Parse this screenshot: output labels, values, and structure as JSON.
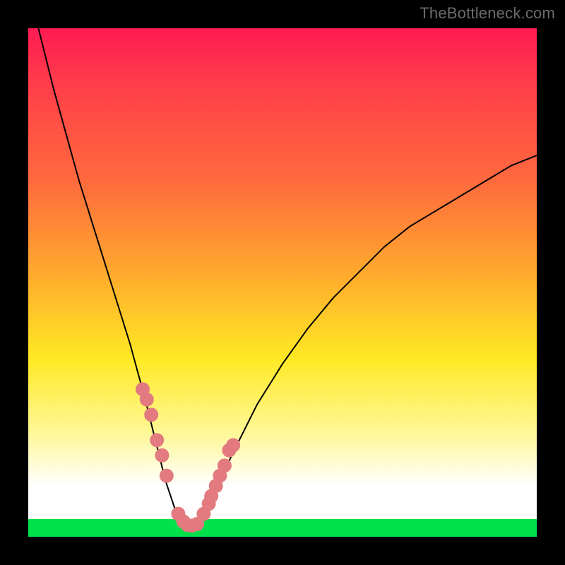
{
  "watermark": "TheBottleneck.com",
  "chart_data": {
    "type": "line",
    "title": "",
    "xlabel": "",
    "ylabel": "",
    "xlim": [
      0,
      100
    ],
    "ylim": [
      0,
      100
    ],
    "grid": false,
    "legend": false,
    "series": [
      {
        "name": "curve",
        "x": [
          2,
          5,
          10,
          15,
          20,
          23,
          25,
          27,
          29,
          30,
          31,
          32,
          33,
          35,
          37,
          40,
          45,
          50,
          55,
          60,
          65,
          70,
          75,
          80,
          85,
          90,
          95,
          100
        ],
        "y": [
          100,
          88,
          70,
          54,
          38,
          27,
          19,
          11,
          5,
          3,
          2,
          2,
          2.5,
          5,
          9,
          16,
          26,
          34,
          41,
          47,
          52,
          57,
          61,
          64,
          67,
          70,
          73,
          75
        ]
      }
    ],
    "highlight_points": {
      "name": "dots",
      "color": "#e27a7f",
      "x": [
        22.5,
        23.3,
        24.2,
        25.3,
        26.3,
        27.2,
        29.5,
        30.5,
        31.3,
        32.2,
        33.2,
        34.5,
        35.5,
        36.0,
        36.9,
        37.7,
        38.6,
        39.5,
        40.3
      ],
      "y": [
        29,
        27,
        24,
        19,
        16,
        12,
        4.5,
        3,
        2.3,
        2.2,
        2.5,
        4.5,
        6.5,
        8,
        10,
        12,
        14,
        17,
        18
      ]
    },
    "background_gradient": {
      "stops": [
        {
          "pos": 0,
          "color": "#ff1a52"
        },
        {
          "pos": 0.3,
          "color": "#ff6a3d"
        },
        {
          "pos": 0.5,
          "color": "#ffb02c"
        },
        {
          "pos": 0.65,
          "color": "#ffe924"
        },
        {
          "pos": 0.8,
          "color": "#fff89a"
        },
        {
          "pos": 0.9,
          "color": "#ffffff"
        },
        {
          "pos": 0.965,
          "color": "#ffffff"
        },
        {
          "pos": 0.965,
          "color": "#00e24a"
        },
        {
          "pos": 1.0,
          "color": "#00e24a"
        }
      ]
    }
  }
}
